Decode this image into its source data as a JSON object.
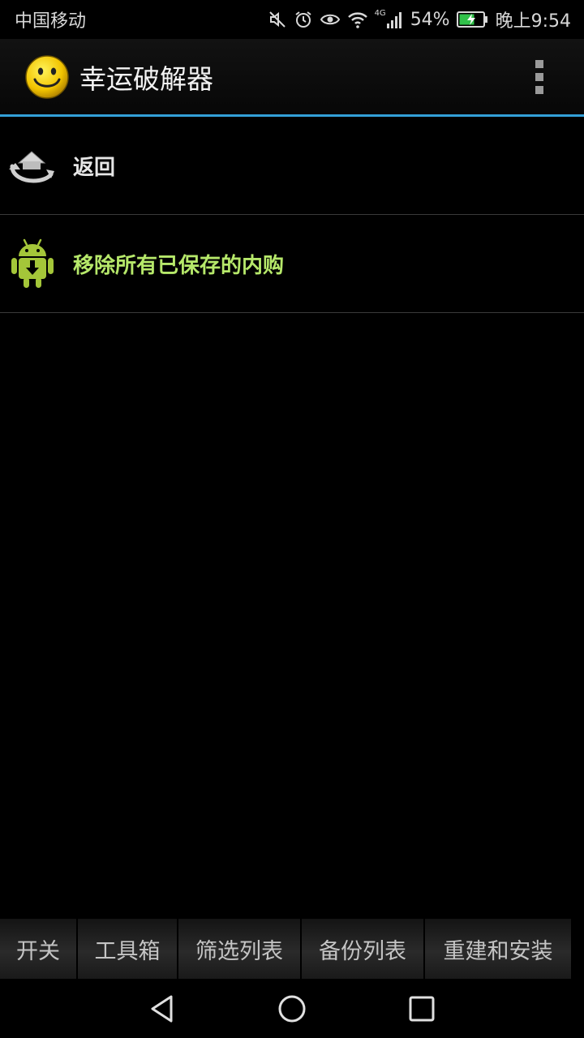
{
  "status_bar": {
    "carrier": "中国移动",
    "network": "4G",
    "battery": "54%",
    "time": "晚上9:54",
    "icons": [
      "mute-icon",
      "alarm-icon",
      "eye-icon",
      "wifi-icon",
      "signal-icon",
      "battery-charging-icon"
    ]
  },
  "action_bar": {
    "title": "幸运破解器",
    "app_icon": "smiley-icon",
    "menu_icon": "overflow-menu-icon"
  },
  "list": {
    "items": [
      {
        "label": "返回",
        "icon": "back-rotate-icon",
        "color": "#e6e6e6"
      },
      {
        "label": "移除所有已保存的内购",
        "icon": "android-download-icon",
        "color": "#b6e86a"
      }
    ]
  },
  "tabs": [
    "开关",
    "工具箱",
    "筛选列表",
    "备份列表",
    "重建和安装"
  ],
  "nav": [
    "back-nav-icon",
    "home-nav-icon",
    "recents-nav-icon"
  ],
  "colors": {
    "accent": "#33a0d8",
    "highlight": "#b6e86a",
    "background": "#000000"
  }
}
